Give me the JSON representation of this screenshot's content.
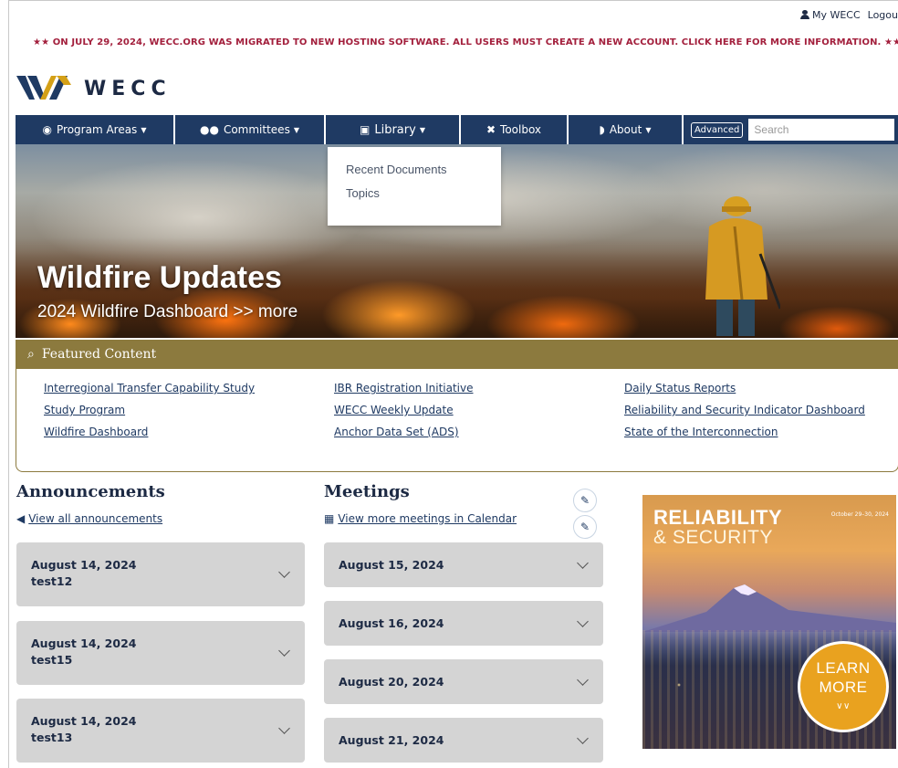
{
  "utility": {
    "my_wecc": "My WECC",
    "logout": "Logou"
  },
  "alert": "★★ ON JULY 29, 2024, WECC.ORG WAS MIGRATED TO NEW HOSTING SOFTWARE. ALL USERS MUST CREATE A NEW ACCOUNT. CLICK HERE FOR MORE INFORMATION. ★★",
  "logo": {
    "text": "WECC"
  },
  "nav": {
    "program_areas": "Program Areas",
    "committees": "Committees",
    "library": "Library",
    "toolbox": "Toolbox",
    "about": "About",
    "advanced": "Advanced",
    "search_placeholder": "Search"
  },
  "library_menu": {
    "items": [
      "Recent Documents",
      "Topics"
    ]
  },
  "hero": {
    "title": "Wildfire Updates",
    "subtitle": "2024 Wildfire Dashboard >> more"
  },
  "featured": {
    "heading": "Featured Content",
    "col1": [
      "Interregional Transfer Capability Study",
      "Study Program",
      "Wildfire Dashboard"
    ],
    "col2": [
      "IBR Registration Initiative",
      "WECC Weekly Update",
      "Anchor Data Set (ADS)"
    ],
    "col3": [
      "Daily Status Reports",
      "Reliability and Security Indicator Dashboard",
      "State of the Interconnection"
    ]
  },
  "announcements": {
    "title": "Announcements",
    "view_all": "View all announcements",
    "items": [
      {
        "date": "August 14, 2024",
        "name": "test12"
      },
      {
        "date": "August 14, 2024",
        "name": "test15"
      },
      {
        "date": "August 14, 2024",
        "name": "test13"
      }
    ]
  },
  "meetings": {
    "title": "Meetings",
    "view_more": "View more meetings in Calendar",
    "items": [
      {
        "date": "August 15, 2024"
      },
      {
        "date": "August 16, 2024"
      },
      {
        "date": "August 20, 2024"
      },
      {
        "date": "August 21, 2024"
      }
    ]
  },
  "ad": {
    "title": "RELIABILITY",
    "subtitle": "& SECURITY",
    "date": "October 29–30, 2024",
    "button_line1": "LEARN",
    "button_line2": "MORE"
  },
  "colors": {
    "navy": "#1f3a63",
    "gold": "#8c7a3e",
    "alert_red": "#a3203d",
    "card_gray": "#d4d4d4"
  }
}
